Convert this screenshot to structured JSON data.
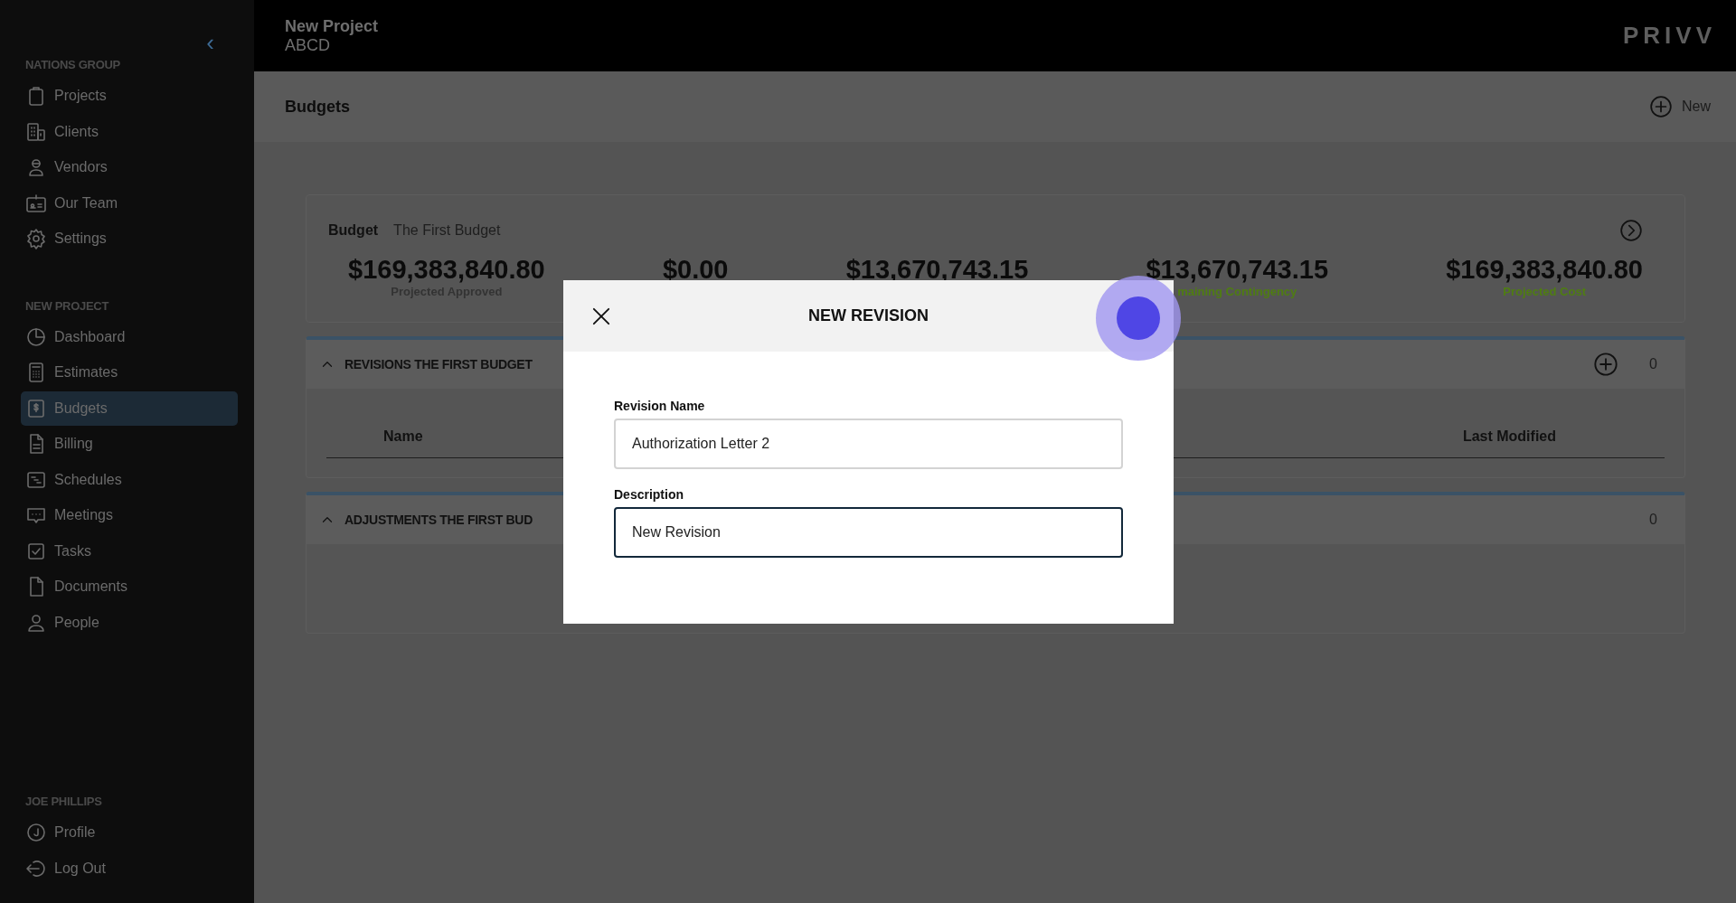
{
  "sidebar": {
    "collapse_icon": "‹",
    "sections": [
      {
        "heading": "NATIONS GROUP",
        "items": [
          {
            "label": "Projects",
            "kind": "clipboard",
            "selected": false
          },
          {
            "label": "Clients",
            "kind": "buildings",
            "selected": false
          },
          {
            "label": "Vendors",
            "kind": "worker",
            "selected": false
          },
          {
            "label": "Our Team",
            "kind": "idcard",
            "selected": false
          },
          {
            "label": "Settings",
            "kind": "gear",
            "selected": false
          }
        ]
      },
      {
        "heading": "NEW PROJECT",
        "items": [
          {
            "label": "Dashboard",
            "kind": "pie",
            "selected": false
          },
          {
            "label": "Estimates",
            "kind": "calculator",
            "selected": false
          },
          {
            "label": "Budgets",
            "kind": "dollar",
            "selected": true
          },
          {
            "label": "Billing",
            "kind": "invoice",
            "selected": false
          },
          {
            "label": "Schedules",
            "kind": "gantt",
            "selected": false
          },
          {
            "label": "Meetings",
            "kind": "chat",
            "selected": false
          },
          {
            "label": "Tasks",
            "kind": "check",
            "selected": false
          },
          {
            "label": "Documents",
            "kind": "document",
            "selected": false
          },
          {
            "label": "People",
            "kind": "person",
            "selected": false
          }
        ]
      },
      {
        "heading": "JOE PHILLIPS",
        "items": [
          {
            "label": "Profile",
            "kind": "initial",
            "selected": false
          },
          {
            "label": "Log Out",
            "kind": "logout",
            "selected": false
          }
        ]
      }
    ]
  },
  "header": {
    "project": "New Project",
    "code": "ABCD",
    "logo": "PRIVV"
  },
  "page": {
    "title": "Budgets",
    "new_button": "New"
  },
  "budget_card": {
    "label": "Budget",
    "name": "The First Budget",
    "stats": [
      {
        "amount": "$169,383,840.80",
        "label": "Projected Approved",
        "color": "#333333"
      },
      {
        "amount": "$0.00"
      },
      {
        "amount": "$13,670,743.15"
      },
      {
        "amount": "$13,670,743.15",
        "label": "maining Contingency",
        "color": "#4f7d12"
      },
      {
        "amount": "$169,383,840.80",
        "label": "Projected Cost",
        "color": "#4f7d12"
      }
    ]
  },
  "panels": [
    {
      "kind": "revisions",
      "title": "REVISIONS THE FIRST BUDGET",
      "expanded": true,
      "count": "0",
      "columns": [
        "Name",
        "Last Modified"
      ]
    },
    {
      "kind": "adjustments",
      "title": "ADJUSTMENTS THE FIRST BUD",
      "expanded": true,
      "count": "0"
    }
  ],
  "modal": {
    "title": "NEW REVISION",
    "fields": [
      {
        "label": "Revision Name",
        "value": "Authorization Letter 2",
        "focused": false
      },
      {
        "label": "Description",
        "value": "New Revision",
        "focused": true
      }
    ]
  }
}
